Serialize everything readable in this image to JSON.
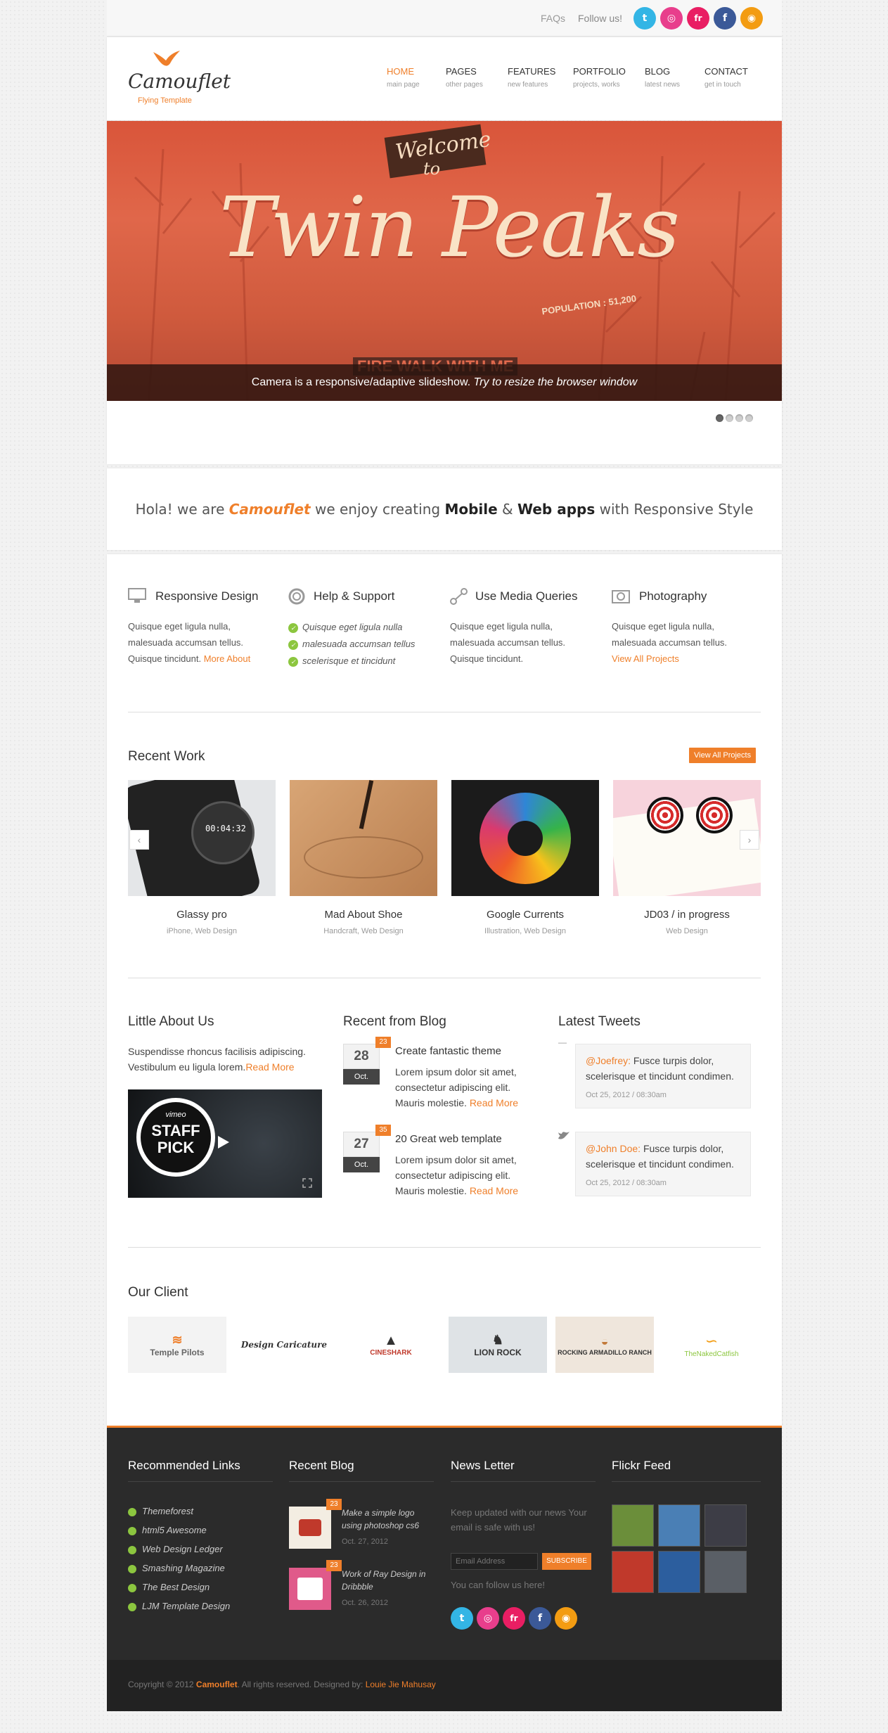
{
  "topbar": {
    "faqs": "FAQs",
    "follow": "Follow us!",
    "social": [
      {
        "name": "twitter",
        "glyph": "t",
        "color": "#33b5e5"
      },
      {
        "name": "dribbble",
        "glyph": "◎",
        "color": "#e83e8c"
      },
      {
        "name": "flickr",
        "glyph": "fr",
        "color": "#e91e63"
      },
      {
        "name": "facebook",
        "glyph": "f",
        "color": "#3b5998"
      },
      {
        "name": "rss",
        "glyph": "◉",
        "color": "#f39c12"
      }
    ]
  },
  "brand": {
    "name": "Camouflet",
    "tagline": "Flying Template",
    "accent": "#ef7f2a"
  },
  "nav": [
    {
      "label": "HOME",
      "sub": "main page"
    },
    {
      "label": "PAGES",
      "sub": "other pages"
    },
    {
      "label": "FEATURES",
      "sub": "new features"
    },
    {
      "label": "PORTFOLIO",
      "sub": "projects, works"
    },
    {
      "label": "BLOG",
      "sub": "latest news"
    },
    {
      "label": "CONTACT",
      "sub": "get in touch"
    }
  ],
  "slider": {
    "welcome": "Welcome",
    "to": "to",
    "headline": "Twin Peaks",
    "population": "POPULATION : 51,200",
    "banner": "FIRE WALK WITH ME",
    "caption_plain": "Camera is a responsive/adaptive slideshow.",
    "caption_italic": "Try to resize the browser window"
  },
  "hola": {
    "p1": "Hola! we are",
    "brand": "Camouflet",
    "p2": "we enjoy creating",
    "b1": "Mobile",
    "amp": "&",
    "b2": "Web apps",
    "p3": "with Responsive Style"
  },
  "features": [
    {
      "icon": "monitor-icon",
      "title": "Responsive Design",
      "text": "Quisque eget ligula nulla, malesuada accumsan tellus. Quisque tincidunt.",
      "link": "More About"
    },
    {
      "icon": "lifebuoy-icon",
      "title": "Help & Support",
      "checks": [
        "Quisque eget ligula nulla",
        "malesuada accumsan tellus",
        "scelerisque et tincidunt"
      ]
    },
    {
      "icon": "share-nodes-icon",
      "title": "Use Media Queries",
      "text": "Quisque eget ligula nulla, malesuada accumsan tellus. Quisque tincidunt."
    },
    {
      "icon": "camera-icon",
      "title": "Photography",
      "text": "Quisque eget ligula nulla, malesuada accumsan tellus.",
      "link": "View All Projects"
    }
  ],
  "recent_work": {
    "title": "Recent Work",
    "button": "View All Projects",
    "items": [
      {
        "title": "Glassy pro",
        "sub": "iPhone, Web Design",
        "time": "00:04:32"
      },
      {
        "title": "Mad About Shoe",
        "sub": "Handcraft, Web Design"
      },
      {
        "title": "Google Currents",
        "sub": "Illustration, Web Design"
      },
      {
        "title": "JD03 / in progress",
        "sub": "Web Design"
      }
    ]
  },
  "about": {
    "title": "Little About Us",
    "text": "Suspendisse rhoncus facilisis adipiscing. Vestibulum eu ligula lorem.",
    "link": "Read More",
    "video_brand": "vimeo",
    "video_l1": "STAFF",
    "video_l2": "PICK"
  },
  "blog": {
    "title": "Recent from Blog",
    "posts": [
      {
        "day": "28",
        "month": "Oct.",
        "comments": "23",
        "title": "Create fantastic theme",
        "text": "Lorem ipsum dolor sit amet, consectetur adipiscing elit. Mauris molestie.",
        "link": "Read More"
      },
      {
        "day": "27",
        "month": "Oct.",
        "comments": "35",
        "title": "20 Great web template",
        "text": "Lorem ipsum dolor sit amet, consectetur adipiscing elit. Mauris molestie.",
        "link": "Read More"
      }
    ]
  },
  "tweets": {
    "title": "Latest Tweets",
    "items": [
      {
        "user": "@Joefrey:",
        "text": "Fusce turpis dolor, scelerisque et tincidunt condimen.",
        "time": "Oct 25, 2012 / 08:30am"
      },
      {
        "user": "@John Doe:",
        "text": "Fusce turpis dolor, scelerisque et tincidunt condimen.",
        "time": "Oct 25, 2012 / 08:30am"
      }
    ]
  },
  "clients": {
    "title": "Our Client",
    "logos": [
      "Temple Pilots",
      "Design Caricature",
      "CINESHARK",
      "LION ROCK",
      "ROCKING ARMADILLO RANCH",
      "TheNakedCatfish"
    ]
  },
  "footer": {
    "links_title": "Recommended Links",
    "links": [
      "Themeforest",
      "html5 Awesome",
      "Web Design Ledger",
      "Smashing Magazine",
      "The Best Design",
      "LJM Template Design"
    ],
    "blog_title": "Recent Blog",
    "blog": [
      {
        "title": "Make a simple logo using photoshop cs6",
        "date": "Oct. 27, 2012",
        "count": "23"
      },
      {
        "title": "Work of Ray Design in Dribbble",
        "date": "Oct. 26, 2012",
        "count": "23"
      }
    ],
    "news_title": "News Letter",
    "news_text": "Keep updated with our news Your email is safe with us!",
    "email_placeholder": "Email Address",
    "subscribe": "SUBSCRIBE",
    "follow_text": "You can follow us here!",
    "flickr_title": "Flickr Feed",
    "flickr_colors": [
      "#6b8e3a",
      "#4a7fb5",
      "#3d3d46",
      "#c0392b",
      "#2c5e9e",
      "#5a5f66"
    ],
    "copyright_pre": "Copyright © 2012",
    "copyright_brand": "Camouflet",
    "copyright_mid": ". All rights reserved. Designed by:",
    "designer": "Louie Jie Mahusay"
  }
}
